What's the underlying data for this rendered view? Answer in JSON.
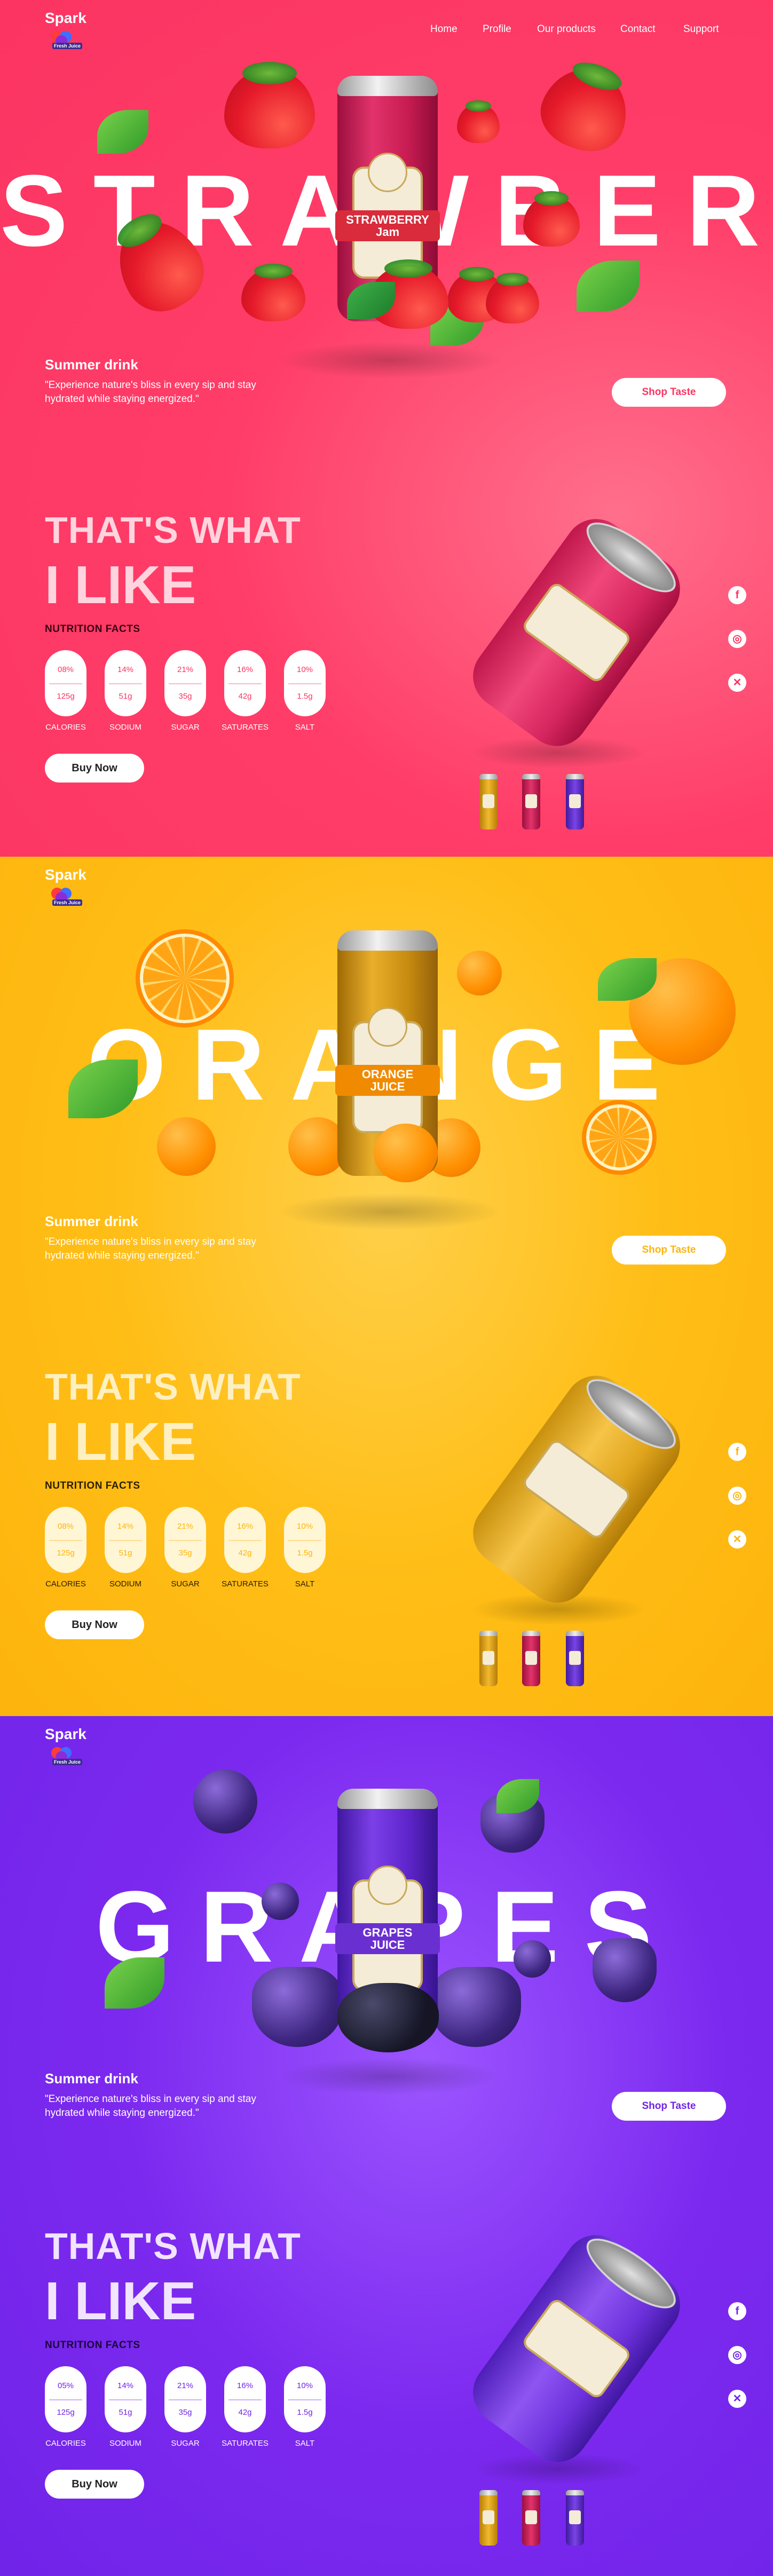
{
  "brand": {
    "name": "Spark",
    "tagline": "Fresh Juice"
  },
  "nav": [
    {
      "label": "Home"
    },
    {
      "label": "Profile"
    },
    {
      "label": "Our products"
    },
    {
      "label": "Contact"
    },
    {
      "label": "Support"
    }
  ],
  "sections": [
    {
      "flavor": "STRAWBERRY",
      "accent": "#fb3462",
      "can_label": [
        "STRAWBERRY",
        "Jam"
      ],
      "summer_title": "Summer drink",
      "summer_quote": "\"Experience nature's bliss in every sip and stay hydrated while staying energized.\"",
      "shop_label": "Shop Taste",
      "heading_line1": "THAT'S WHAT",
      "heading_line2": "I LIKE",
      "nutrition_title": "NUTRITION FACTS",
      "nutrition": [
        {
          "percent": "08%",
          "value": "125g",
          "label": "CALORIES"
        },
        {
          "percent": "14%",
          "value": "51g",
          "label": "SODIUM"
        },
        {
          "percent": "21%",
          "value": "35g",
          "label": "SUGAR"
        },
        {
          "percent": "16%",
          "value": "42g",
          "label": "SATURATES"
        },
        {
          "percent": "10%",
          "value": "1.5g",
          "label": "SALT"
        }
      ],
      "buy_label": "Buy Now"
    },
    {
      "flavor": "ORANGE",
      "accent": "#fdb40c",
      "can_label": [
        "ORANGE",
        "JUICE"
      ],
      "summer_title": "Summer drink",
      "summer_quote": "\"Experience nature's bliss in every sip and stay hydrated while staying energized.\"",
      "shop_label": "Shop Taste",
      "heading_line1": "THAT'S WHAT",
      "heading_line2": "I LIKE",
      "nutrition_title": "NUTRITION FACTS",
      "nutrition": [
        {
          "percent": "08%",
          "value": "125g",
          "label": "CALORIES"
        },
        {
          "percent": "14%",
          "value": "51g",
          "label": "SODIUM"
        },
        {
          "percent": "21%",
          "value": "35g",
          "label": "SUGAR"
        },
        {
          "percent": "16%",
          "value": "42g",
          "label": "SATURATES"
        },
        {
          "percent": "10%",
          "value": "1.5g",
          "label": "SALT"
        }
      ],
      "buy_label": "Buy Now"
    },
    {
      "flavor": "GRAPES",
      "accent": "#7024e8",
      "can_label": [
        "GRAPES",
        "JUICE"
      ],
      "summer_title": "Summer drink",
      "summer_quote": "\"Experience nature's bliss in every sip and stay hydrated while staying energized.\"",
      "shop_label": "Shop Taste",
      "heading_line1": "THAT'S WHAT",
      "heading_line2": "I LIKE",
      "nutrition_title": "NUTRITION FACTS",
      "nutrition": [
        {
          "percent": "05%",
          "value": "125g",
          "label": "CALORIES"
        },
        {
          "percent": "14%",
          "value": "51g",
          "label": "SODIUM"
        },
        {
          "percent": "21%",
          "value": "35g",
          "label": "SUGAR"
        },
        {
          "percent": "16%",
          "value": "42g",
          "label": "SATURATES"
        },
        {
          "percent": "10%",
          "value": "1.5g",
          "label": "SALT"
        }
      ],
      "buy_label": "Buy Now"
    }
  ],
  "social_icons": [
    "facebook-icon",
    "instagram-icon",
    "x-icon"
  ],
  "colors": {
    "strawberry": "#fb3462",
    "orange": "#fdb40c",
    "grape": "#7024e8",
    "heading_pink": "#ffd4de",
    "heading_orange": "#fff0c2",
    "heading_purple": "#f1e4ff"
  }
}
